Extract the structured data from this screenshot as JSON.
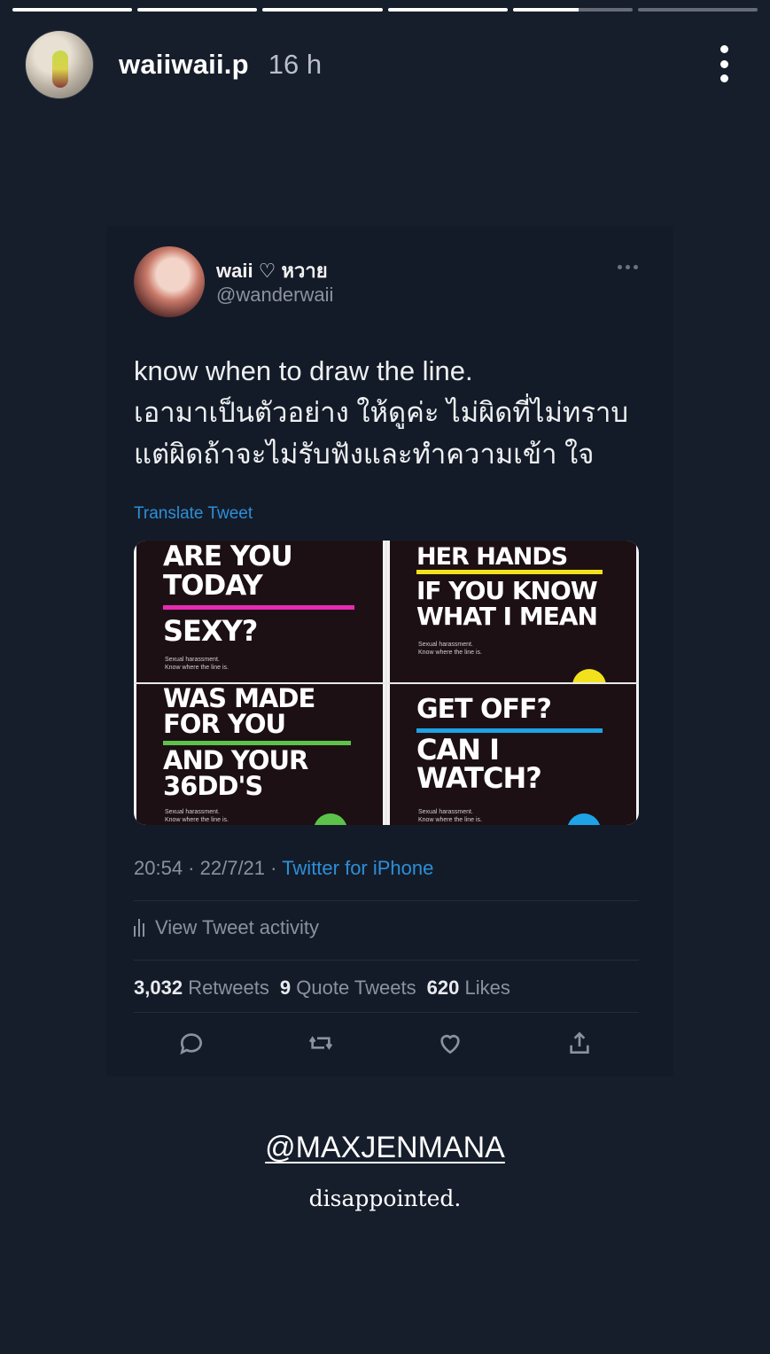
{
  "story": {
    "progress": [
      1,
      1,
      1,
      1,
      0.55,
      0
    ],
    "username": "waiiwaii.p",
    "time_ago": "16 h"
  },
  "tweet": {
    "display_name": "waii ♡ หวาย",
    "handle": "@wanderwaii",
    "text": "know when to draw the line.\nเอามาเป็นตัวอย่าง ให้ดูค่ะ ไม่ผิดที่ไม่ทราบ\nแต่ผิดถ้าจะไม่รับฟังและทำความเข้า ใจ",
    "translate_label": "Translate Tweet",
    "media": [
      {
        "headline": "ARE YOU\nTODAY",
        "sub": "SEXY?",
        "small": "Sexual harassment.\nKnow where the line is.",
        "accent": "#e62bb0"
      },
      {
        "headline": "HER HANDS",
        "sub": "IF YOU KNOW\nWHAT I MEAN",
        "small": "Sexual harassment.\nKnow where the line is.",
        "accent": "#f2e21d"
      },
      {
        "headline": "WAS MADE\nFOR YOU",
        "sub": "AND YOUR\n36DD'S",
        "small": "Sexual harassment.\nKnow where the line is.",
        "accent": "#5cc24a"
      },
      {
        "headline": "GET OFF?",
        "sub": "CAN I\nWATCH?",
        "small": "Sexual harassment.\nKnow where the line is.",
        "accent": "#1ea3e6"
      }
    ],
    "time": "20:54",
    "date": "22/7/21",
    "client": "Twitter for iPhone",
    "activity_label": "View Tweet activity",
    "retweets_count": "3,032",
    "retweets_label": "Retweets",
    "quotes_count": "9",
    "quotes_label": "Quote Tweets",
    "likes_count": "620",
    "likes_label": "Likes",
    "icons": [
      "reply-icon",
      "retweet-icon",
      "like-icon",
      "share-icon"
    ]
  },
  "mention": "@MAXJENMANA",
  "caption": "disappointed."
}
